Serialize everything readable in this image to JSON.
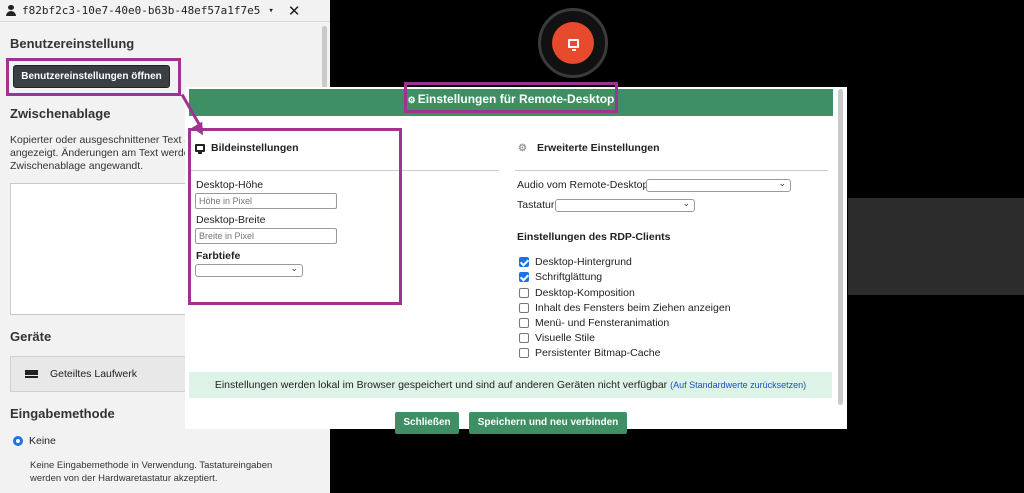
{
  "session": {
    "id": "f82bf2c3-10e7-40e0-b63b-48ef57a1f7e5"
  },
  "sidebar": {
    "user_settings_title": "Benutzereinstellung",
    "open_user_settings_label": "Benutzereinstellungen öffnen",
    "clipboard_title": "Zwischenablage",
    "clipboard_text_1": "Kopierter oder ausgeschnittener Text au",
    "clipboard_text_2": "angezeigt. Änderungen am Text werder",
    "clipboard_text_3": "Zwischenablage angewandt.",
    "clipboard_value": "",
    "devices_title": "Geräte",
    "shared_drive_label": "Geteiltes Laufwerk",
    "input_method_title": "Eingabemethode",
    "input_none_label": "Keine",
    "input_none_desc_1": "Keine Eingabemethode in Verwendung. Tastatureingaben",
    "input_none_desc_2": "werden von der Hardwaretastatur akzeptiert."
  },
  "dialog": {
    "title": "Einstellungen für Remote-Desktop",
    "display_settings_title": "Bildeinstellungen",
    "desktop_height_label": "Desktop-Höhe",
    "desktop_height_placeholder": "Höhe in Pixel",
    "desktop_width_label": "Desktop-Breite",
    "desktop_width_placeholder": "Breite in Pixel",
    "color_depth_label": "Farbtiefe",
    "advanced_title": "Erweiterte Einstellungen",
    "audio_label": "Audio vom Remote-Desktop",
    "keyboard_label": "Tastatur",
    "rdp_client_title": "Einstellungen des RDP-Clients",
    "rdp_options": [
      {
        "label": "Desktop-Hintergrund",
        "checked": true
      },
      {
        "label": "Schriftglättung",
        "checked": true
      },
      {
        "label": "Desktop-Komposition",
        "checked": false
      },
      {
        "label": "Inhalt des Fensters beim Ziehen anzeigen",
        "checked": false
      },
      {
        "label": "Menü- und Fensteranimation",
        "checked": false
      },
      {
        "label": "Visuelle Stile",
        "checked": false
      },
      {
        "label": "Persistenter Bitmap-Cache",
        "checked": false
      }
    ],
    "info_text": "Einstellungen werden lokal im Browser gespeichert und sind auf anderen Geräten nicht verfügbar",
    "reset_link": "(Auf Standardwerte zurücksetzen)",
    "close_label": "Schließen",
    "save_reconnect_label": "Speichern und neu verbinden"
  },
  "colors": {
    "header_green": "#3e8f63",
    "highlight_magenta": "#a0338f",
    "status_red": "#e84a2e"
  }
}
